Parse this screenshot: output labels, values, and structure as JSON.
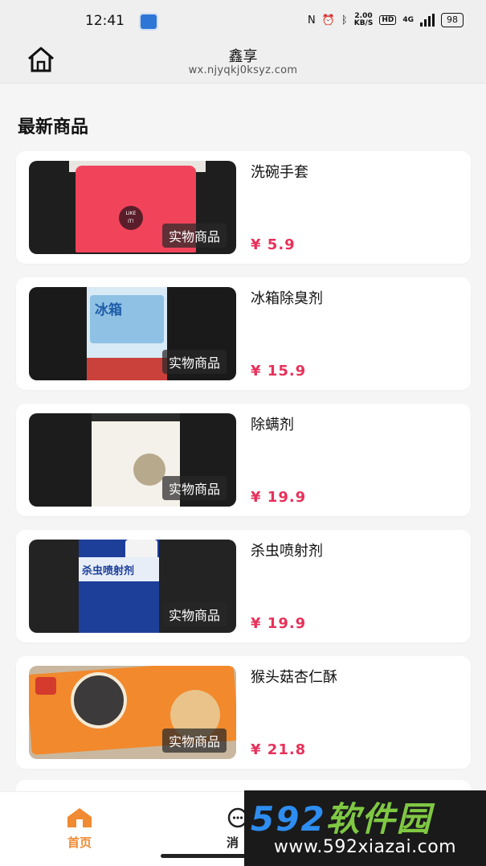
{
  "status_bar": {
    "time": "12:41",
    "net_speed_value": "2.00",
    "net_speed_unit": "KB/S",
    "hd": "HD",
    "signal": "4G",
    "battery": "98"
  },
  "header": {
    "title": "鑫享",
    "url": "wx.njyqkj0ksyz.com",
    "home_icon": "home-icon"
  },
  "section_title": "最新商品",
  "products": [
    {
      "name": "洗碗手套",
      "price": "¥ 5.9",
      "badge": "实物商品"
    },
    {
      "name": "冰箱除臭剂",
      "price": "¥ 15.9",
      "badge": "实物商品",
      "image_text": "冰箱"
    },
    {
      "name": "除螨剂",
      "price": "¥ 19.9",
      "badge": "实物商品"
    },
    {
      "name": "杀虫喷射剂",
      "price": "¥ 19.9",
      "badge": "实物商品",
      "image_text": "杀虫喷射剂"
    },
    {
      "name": "猴头菇杏仁酥",
      "price": "¥ 21.8",
      "badge": "实物商品"
    }
  ],
  "bottom_nav": {
    "home_label": "首页",
    "messages_label": "消",
    "active_color": "#f08a33"
  },
  "watermark": {
    "brand_num": "592",
    "brand_cn": "软件园",
    "url": "www.592xiazai.com"
  },
  "colors": {
    "price": "#e8315a",
    "background": "#f5f5f5"
  }
}
